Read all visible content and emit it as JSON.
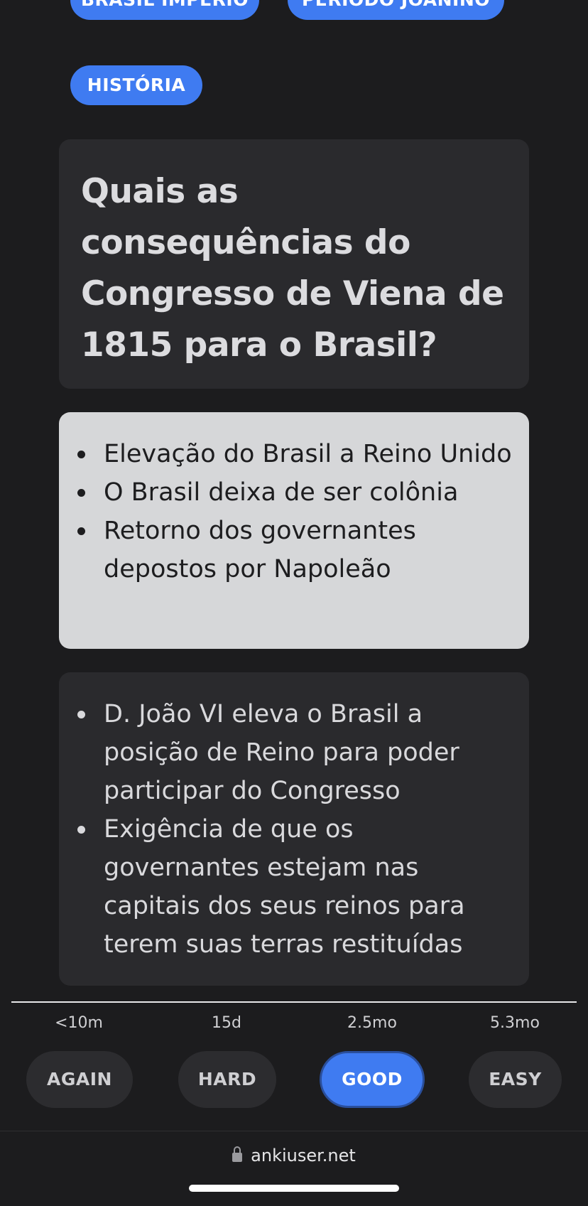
{
  "tags": [
    {
      "label": "BRASIL IMPÉRIO"
    },
    {
      "label": "PERÍODO JOANINO"
    },
    {
      "label": "HISTÓRIA"
    }
  ],
  "question": "Quais as consequências do Congresso de Viena de 1815 para o Brasil?",
  "answer_main": [
    "Elevação do Brasil a Reino Unido",
    "O Brasil deixa de ser colônia",
    "Retorno dos governantes depostos por Napoleão"
  ],
  "answer_extra": [
    "D. João VI eleva o Brasil a posição de Reino para poder participar do Congresso",
    "Exigência de que os governantes estejam nas capitais dos seus reinos para terem suas terras restituídas"
  ],
  "review": {
    "intervals": [
      "<10m",
      "15d",
      "2.5mo",
      "5.3mo"
    ],
    "buttons": [
      "AGAIN",
      "HARD",
      "GOOD",
      "EASY"
    ],
    "selected": "GOOD"
  },
  "browser": {
    "url": "ankiuser.net",
    "lock_icon": "lock-icon"
  },
  "colors": {
    "accent": "#3f7bf1",
    "background": "#1c1c1e",
    "card": "#2a2a2d",
    "answer_card": "#d6d7d9"
  }
}
